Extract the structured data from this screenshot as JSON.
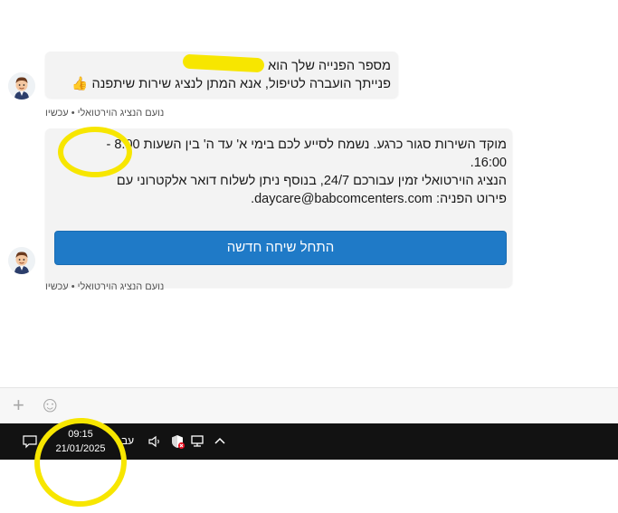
{
  "messages": [
    {
      "line1": "מספר הפנייה שלך הוא",
      "line2": "פנייתך הועברה לטיפול, אנא המתן לנציג שירות שיתפנה",
      "emoji": "👍",
      "meta": "נועם הנציג הוירטואלי • עכשיו"
    },
    {
      "line1": "מוקד השירות סגור כרגע. נשמח לסייע לכם בימי א' עד ה' בין השעות 8:00 -",
      "line2": "16:00.",
      "line3": "הנציג הוירטואלי זמין עבורכם 24/7, בנוסף ניתן לשלוח דואר אלקטרוני עם",
      "line4": "פירוט הפניה: daycare@babcomcenters.com.",
      "button_label": "התחל שיחה חדשה",
      "meta": "נועם הנציג הוירטואלי • עכשיו"
    }
  ],
  "input_bar": {
    "add_icon": "+",
    "emoji_icon": "☺"
  },
  "taskbar": {
    "time": "09:15",
    "date": "21/01/2025",
    "lang": "עב"
  }
}
